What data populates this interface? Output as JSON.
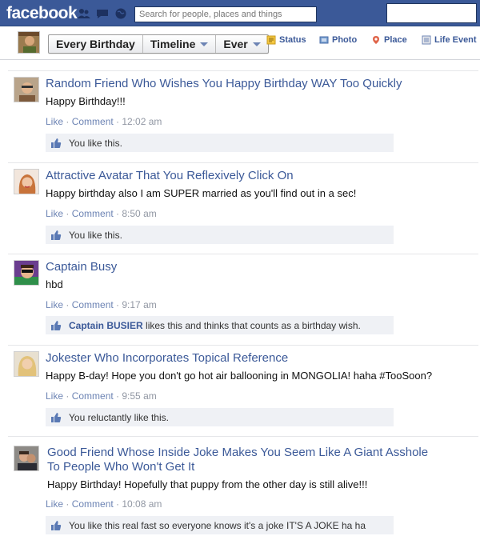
{
  "topbar": {
    "logo": "facebook",
    "search_placeholder": "Search for people, places and things"
  },
  "composer": {
    "filters": [
      {
        "label": "Every Birthday"
      },
      {
        "label": "Timeline"
      },
      {
        "label": "Ever"
      }
    ],
    "actions": [
      {
        "label": "Status",
        "icon": "status-icon"
      },
      {
        "label": "Photo",
        "icon": "photo-icon"
      },
      {
        "label": "Place",
        "icon": "place-pin-icon"
      },
      {
        "label": "Life Event",
        "icon": "life-event-icon"
      }
    ]
  },
  "feed": {
    "like_label": "Like",
    "dot": " · ",
    "comment_label": "Comment",
    "posts": [
      {
        "author": "Random Friend Who Wishes You Happy Birthday WAY Too Quickly",
        "message": "Happy Birthday!!!",
        "time": "12:02 am",
        "likes_text": "You like this."
      },
      {
        "author": "Attractive Avatar That You Reflexively Click On",
        "message": "Happy birthday also I am SUPER married as you'll find out in a sec!",
        "time": "8:50 am",
        "likes_text": "You like this."
      },
      {
        "author": "Captain Busy",
        "message": "hbd",
        "time": "9:17 am",
        "liker": "Captain BUSIER",
        "likes_text": "likes this and thinks that counts as a birthday wish."
      },
      {
        "author": "Jokester Who Incorporates Topical Reference",
        "message": "Happy B-day! Hope you don't go hot air ballooning in MONGOLIA! haha #TooSoon?",
        "time": "9:55 am",
        "likes_text": "You reluctantly like this."
      },
      {
        "author_line1": "Good Friend Whose Inside Joke Makes You Seem Like A Giant Asshole",
        "author_line2": "To People Who Won't Get It",
        "message": "Happy Birthday! Hopefully that puppy from the other day is still alive!!!",
        "time": "10:08 am",
        "likes_text": "You like this real fast so everyone knows it's a joke IT'S A JOKE ha ha"
      }
    ]
  }
}
